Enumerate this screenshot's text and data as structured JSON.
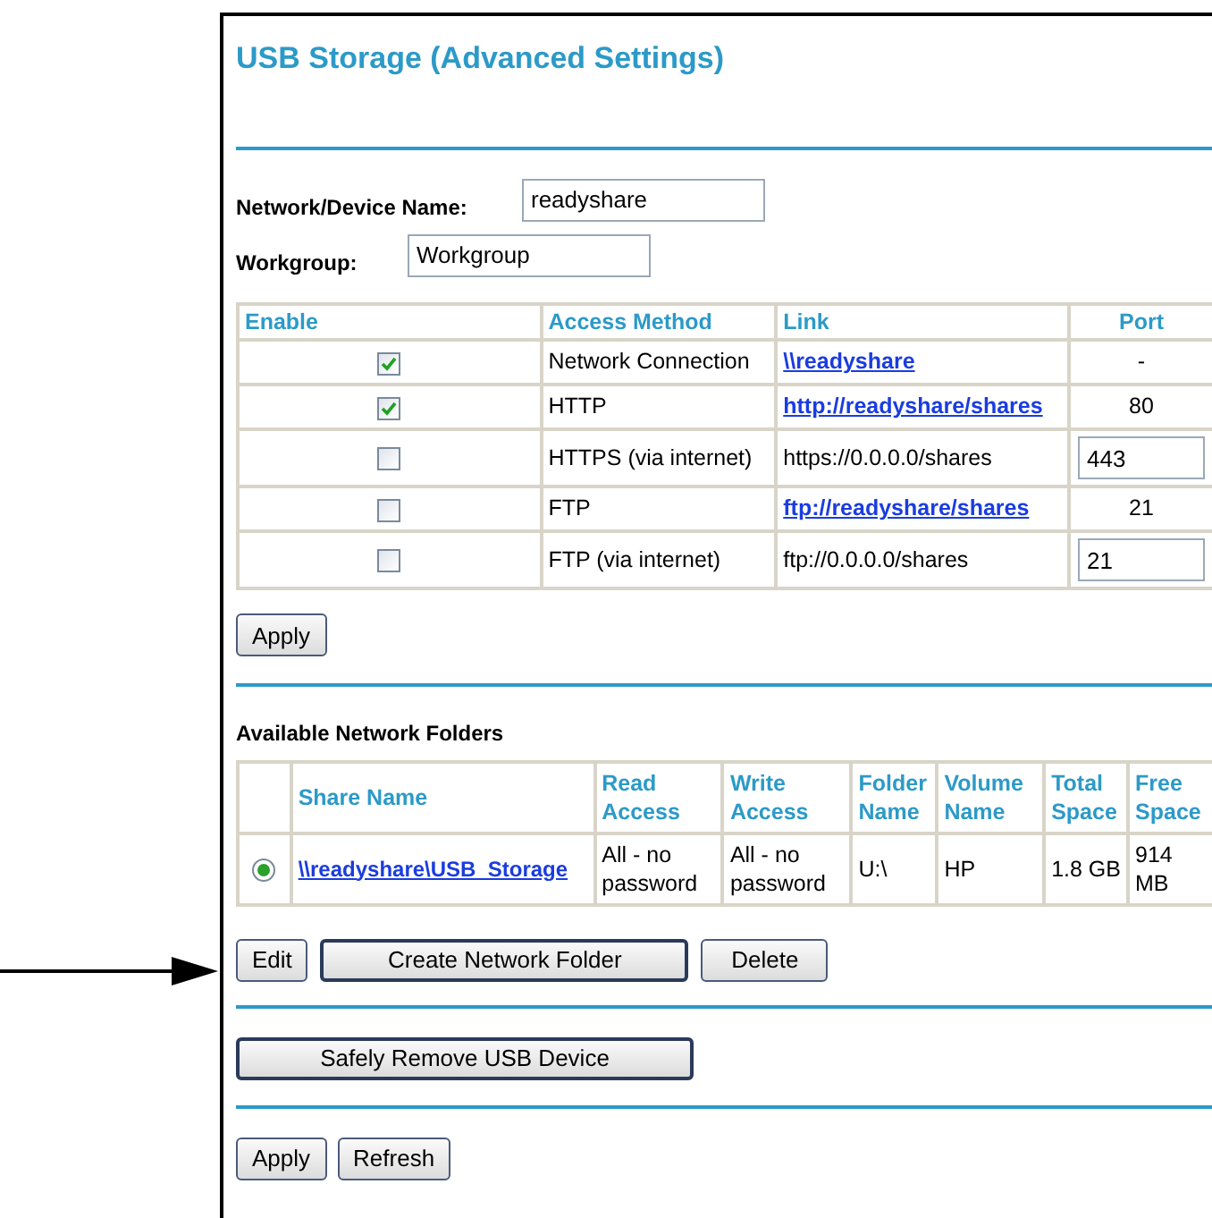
{
  "title": "USB Storage (Advanced Settings)",
  "fields": [
    {
      "label": "Network/Device Name:",
      "value": "readyshare"
    },
    {
      "label": "Workgroup:",
      "value": "Workgroup"
    }
  ],
  "access_table": {
    "columns": [
      "Enable",
      "Access Method",
      "Link",
      "Port"
    ],
    "rows": [
      {
        "checked": true,
        "method": "Network Connection",
        "link": {
          "kind": "link",
          "text": "\\\\readyshare"
        },
        "port": {
          "kind": "text",
          "text": "-"
        }
      },
      {
        "checked": true,
        "method": "HTTP",
        "link": {
          "kind": "link",
          "text": "http://readyshare/shares"
        },
        "port": {
          "kind": "text",
          "text": "80"
        }
      },
      {
        "checked": false,
        "method": "HTTPS (via internet)",
        "link": {
          "kind": "text",
          "text": "https://0.0.0.0/shares"
        },
        "port": {
          "kind": "input",
          "text": "443"
        }
      },
      {
        "checked": false,
        "method": "FTP",
        "link": {
          "kind": "link",
          "text": "ftp://readyshare/shares"
        },
        "port": {
          "kind": "text",
          "text": "21"
        }
      },
      {
        "checked": false,
        "method": "FTP (via internet)",
        "link": {
          "kind": "text",
          "text": "ftp://0.0.0.0/shares"
        },
        "port": {
          "kind": "input",
          "text": "21"
        }
      }
    ]
  },
  "apply_button": "Apply",
  "folders_heading": "Available Network Folders",
  "folders_table": {
    "columns": [
      "Share Name",
      "Read Access",
      "Write Access",
      "Folder Name",
      "Volume Name",
      "Total Space",
      "Free Space"
    ],
    "rows": [
      {
        "selected": true,
        "cells": [
          "\\\\readyshare\\USB_Storage",
          "All - no password",
          "All - no password",
          "U:\\",
          "HP",
          "1.8 GB",
          "914 MB"
        ]
      }
    ]
  },
  "folder_buttons": [
    "Edit",
    "Create Network Folder",
    "Delete"
  ],
  "remove_button": "Safely Remove USB Device",
  "bottom_buttons": [
    "Apply",
    "Refresh"
  ]
}
